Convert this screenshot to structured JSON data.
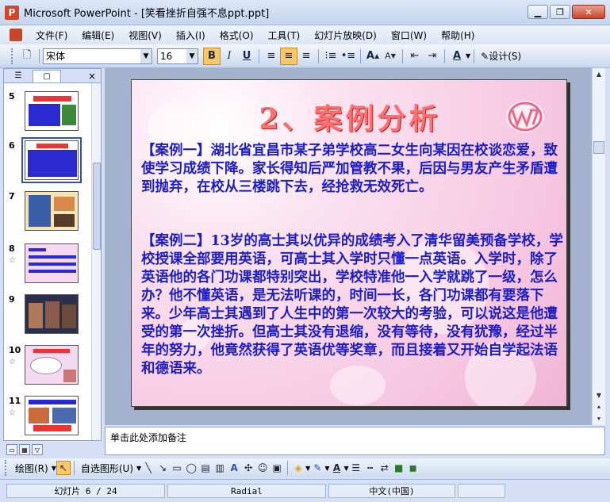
{
  "window": {
    "title": "Microsoft PowerPoint - [笑看挫折自强不息ppt.ppt]",
    "app_icon_letter": "P",
    "controls": {
      "minimize": "▁",
      "restore": "❐",
      "close": "✕"
    }
  },
  "menu": [
    "文件(F)",
    "编辑(E)",
    "视图(V)",
    "插入(I)",
    "格式(O)",
    "工具(T)",
    "幻灯片放映(D)",
    "窗口(W)",
    "帮助(H)"
  ],
  "toolbar": {
    "font_name": "宋体",
    "font_size": "16",
    "bold": "B",
    "italic": "I",
    "underline": "U",
    "design_label": "设计(S)",
    "font_color_label": "A",
    "grow_label": "A",
    "shrink_label": "A"
  },
  "left_pane": {
    "tabs": [
      "outline-tab",
      "slides-tab"
    ],
    "close": "×",
    "thumbnails": [
      {
        "number": "5",
        "star": ""
      },
      {
        "number": "6",
        "star": "",
        "selected": true
      },
      {
        "number": "7",
        "star": ""
      },
      {
        "number": "8",
        "star": "☆"
      },
      {
        "number": "9",
        "star": ""
      },
      {
        "number": "10",
        "star": "☆"
      },
      {
        "number": "11",
        "star": "☆"
      }
    ]
  },
  "slide": {
    "title": "2、案例分析",
    "case1": "【案例一】湖北省宜昌市某子弟学校高二女生向某因在校谈恋爱，致使学习成绩下降。家长得知后严加管教不果，后因与男友产生矛盾遭到抛弃，在校从三楼跳下去，经抢救无效死亡。",
    "case2": "【案例二】13岁的高士其以优异的成绩考入了清华留美预备学校，学校授课全部要用英语，可高士其入学时只懂一点英语。入学时，除了英语他的各门功课都特别突出，学校特准他一入学就跳了一级，怎么办？他不懂英语，是无法听课的，时间一长，各门功课都有要落下来。少年高士其遇到了人生中的第一次较大的考验，可以说这是他遭受的第一次挫折。但高士其没有退缩，没有等待，没有犹豫，经过半年的努力，他竟然获得了英语优等奖章，而且接着又开始自学起法语和德语来。",
    "title_color": "#ff6f6f",
    "text_color": "#1c1cc8"
  },
  "notes": {
    "placeholder": "单击此处添加备注"
  },
  "drawing_toolbar": {
    "draw_label": "绘图(R)",
    "autoshapes_label": "自选图形(U)"
  },
  "status": {
    "slide": "幻灯片 6 / 24",
    "design": "Radial",
    "language": "中文(中国)"
  }
}
